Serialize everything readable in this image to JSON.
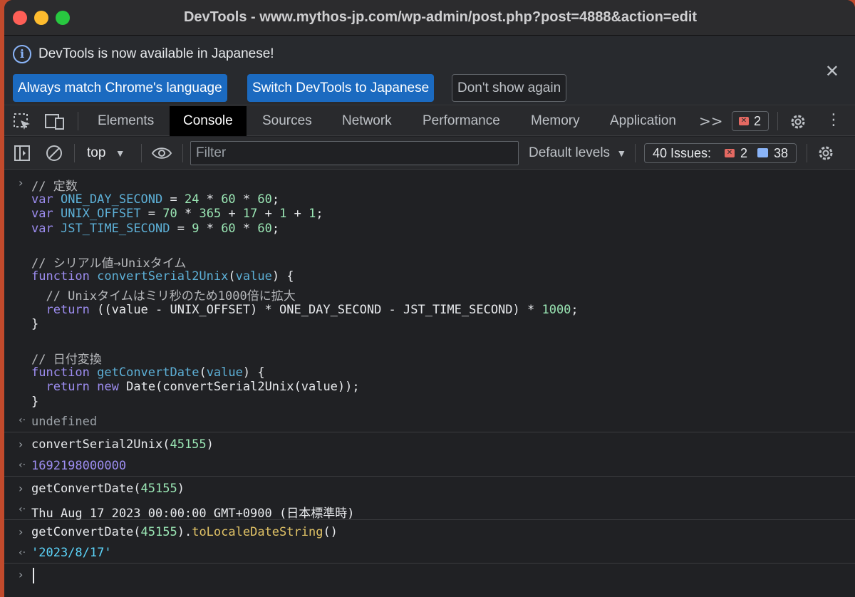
{
  "window": {
    "title": "DevTools - www.mythos-jp.com/wp-admin/post.php?post=4888&action=edit"
  },
  "infobar": {
    "message": "DevTools is now available in Japanese!",
    "btn_always": "Always match Chrome's language",
    "btn_switch": "Switch DevTools to Japanese",
    "btn_dont_show": "Don't show again",
    "close_icon": "close-icon"
  },
  "tabs": {
    "items": [
      "Elements",
      "Console",
      "Sources",
      "Network",
      "Performance",
      "Memory",
      "Application"
    ],
    "active": "Console",
    "more": ">>",
    "error_count": "2"
  },
  "console_toolbar": {
    "context": "top",
    "filter_placeholder": "Filter",
    "levels": "Default levels",
    "issues_label": "40 Issues:",
    "issues_errors": "2",
    "issues_messages": "38"
  },
  "console": {
    "code_lines": [
      "// 定数",
      "var ONE_DAY_SECOND = 24 * 60 * 60;",
      "var UNIX_OFFSET = 70 * 365 + 17 + 1 + 1;",
      "var JST_TIME_SECOND = 9 * 60 * 60;",
      "",
      "// シリアル値→Unixタイム",
      "function convertSerial2Unix(value) {",
      "  // Unixタイムはミリ秒のため1000倍に拡大",
      "  return ((value - UNIX_OFFSET) * ONE_DAY_SECOND - JST_TIME_SECOND) * 1000;",
      "}",
      "",
      "// 日付変換",
      "function getConvertDate(value) {",
      "  return new Date(convertSerial2Unix(value));",
      "}"
    ],
    "result_1": "undefined",
    "input_2_fn": "convertSerial2Unix(",
    "input_2_arg": "45155",
    "input_2_close": ")",
    "result_2": "1692198000000",
    "input_3_fn": "getConvertDate(",
    "input_3_arg": "45155",
    "input_3_close": ")",
    "result_3": "Thu Aug 17 2023 00:00:00 GMT+0900 (日本標準時)",
    "input_4_fn": "getConvertDate(",
    "input_4_arg": "45155",
    "input_4_mid": ").",
    "input_4_method": "toLocaleDateString",
    "input_4_close": "()",
    "result_4": "'2023/8/17'"
  }
}
